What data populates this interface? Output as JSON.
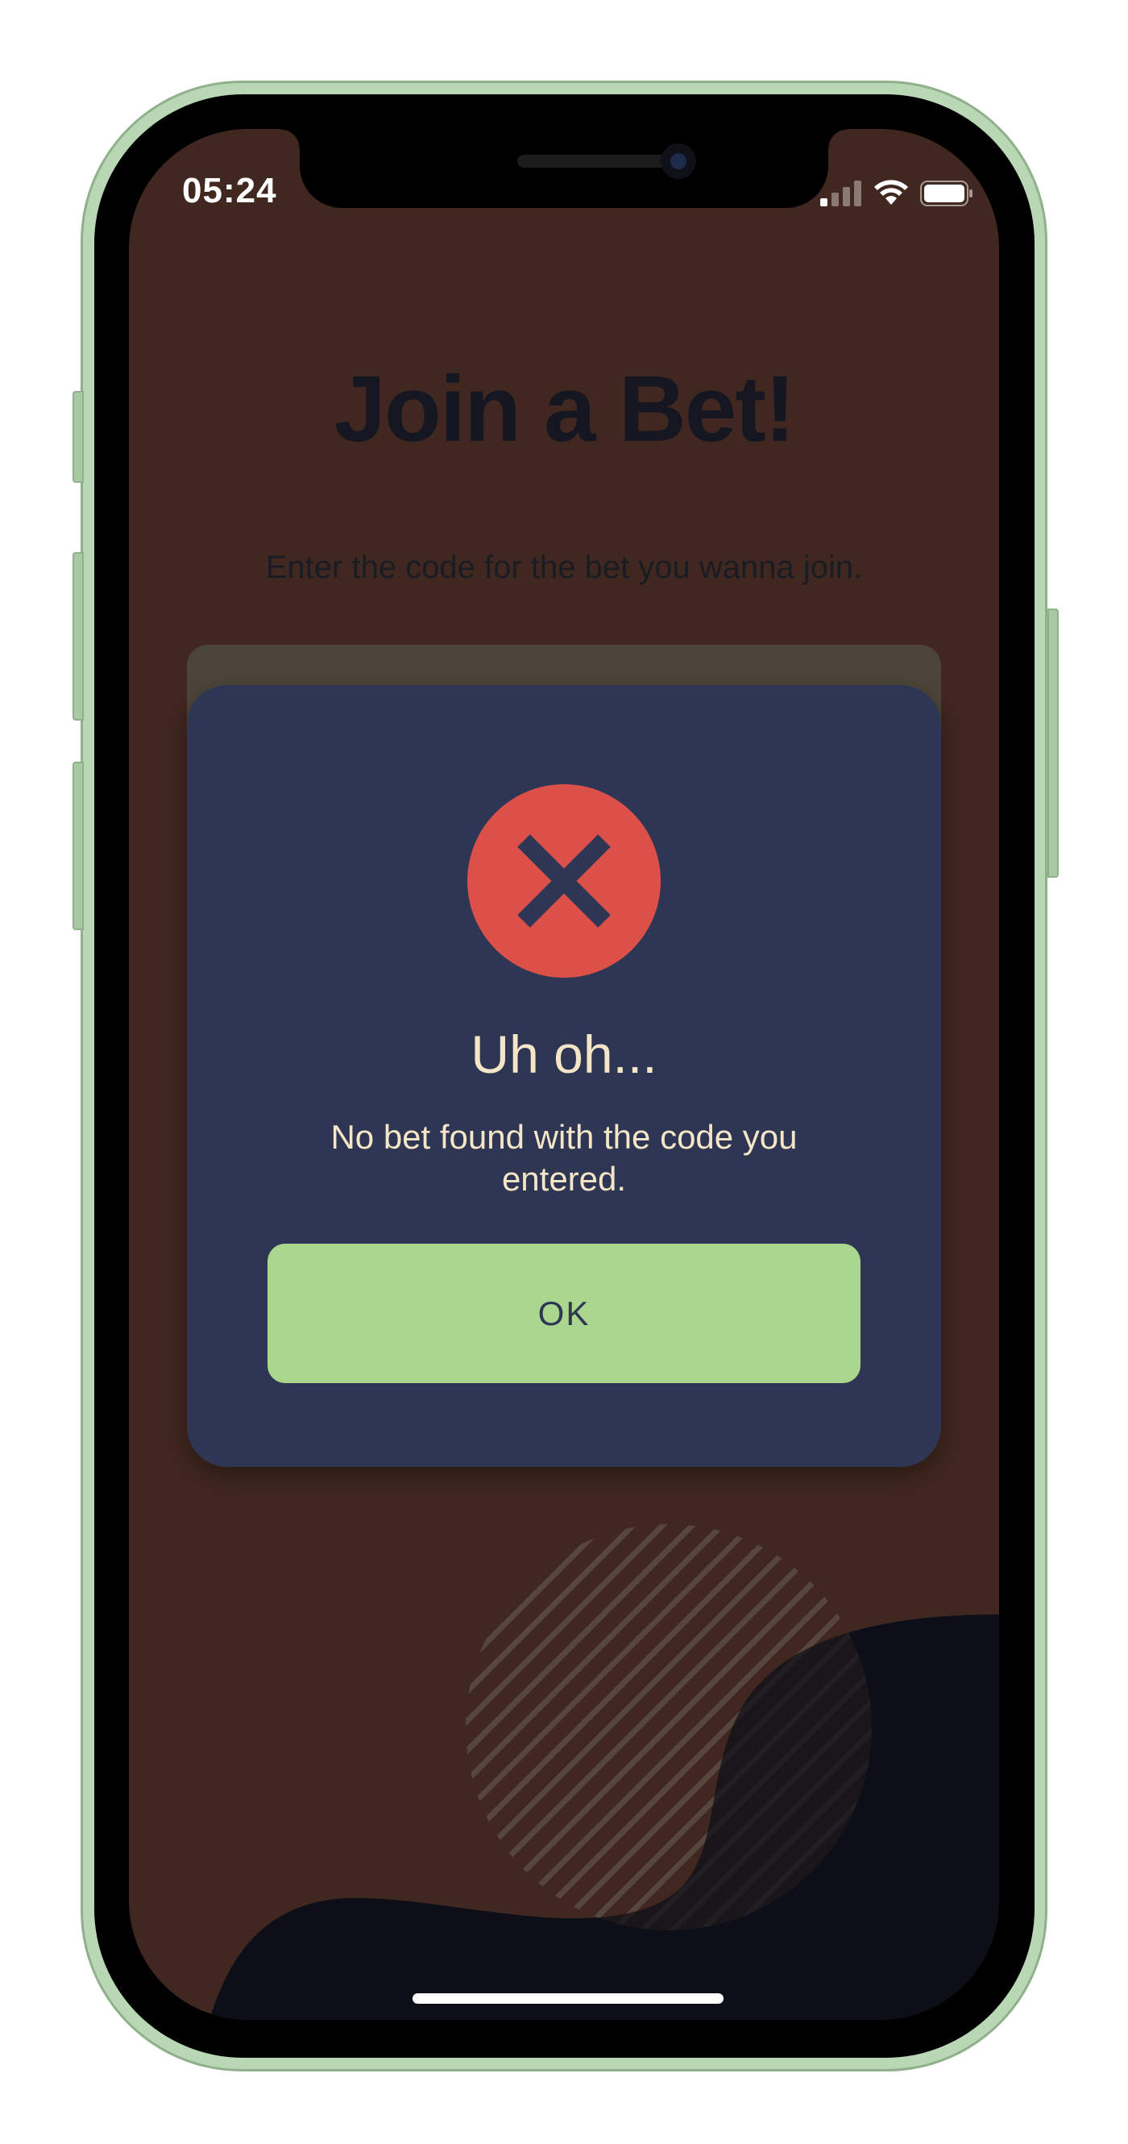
{
  "status_bar": {
    "time": "05:24",
    "icons": [
      "cellular-signal-icon",
      "wifi-icon",
      "battery-icon"
    ]
  },
  "page": {
    "title": "Join a Bet!",
    "subtitle": "Enter the code for the bet you wanna join."
  },
  "dialog": {
    "icon": "error-x-icon",
    "title": "Uh oh...",
    "message": "No bet found with the code you entered.",
    "ok_label": "OK"
  },
  "colors": {
    "background": "#40271f",
    "dialog_background": "#2e3654",
    "error_red": "#dc504a",
    "ok_button_green": "#aad78d",
    "dialog_text": "#f6e6c8",
    "title_text": "#141722",
    "dark_blob": "#0c0f17"
  }
}
